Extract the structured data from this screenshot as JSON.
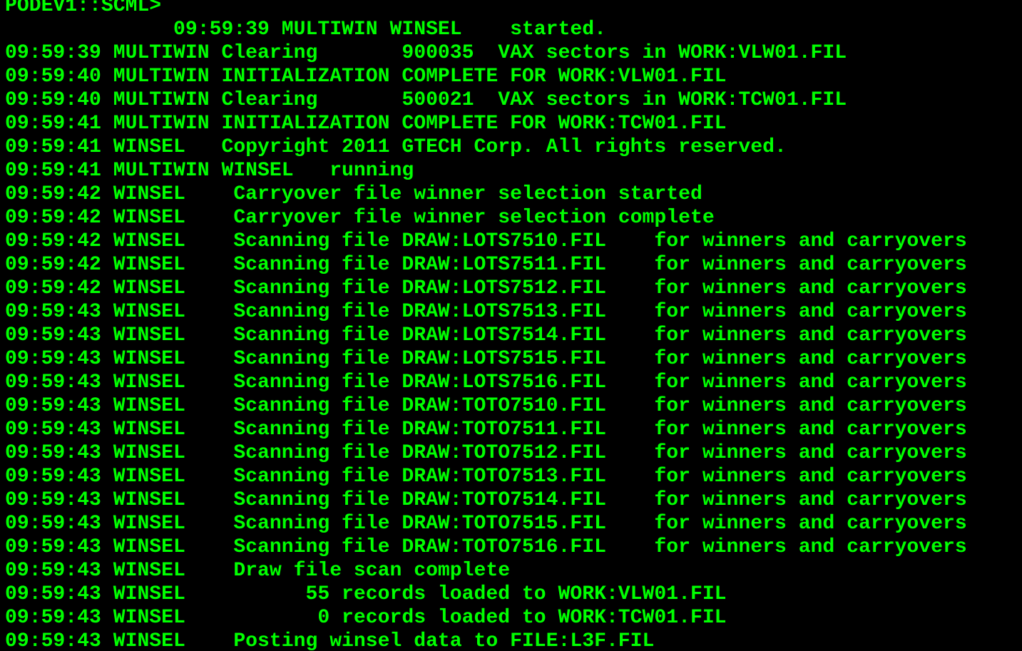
{
  "terminal": {
    "text_color": "#00ff00",
    "background_color": "#000000",
    "lines": [
      "PODEV1::SCML>",
      "              09:59:39 MULTIWIN WINSEL    started.",
      "09:59:39 MULTIWIN Clearing       900035  VAX sectors in WORK:VLW01.FIL",
      "09:59:40 MULTIWIN INITIALIZATION COMPLETE FOR WORK:VLW01.FIL",
      "09:59:40 MULTIWIN Clearing       500021  VAX sectors in WORK:TCW01.FIL",
      "09:59:41 MULTIWIN INITIALIZATION COMPLETE FOR WORK:TCW01.FIL",
      "09:59:41 WINSEL   Copyright 2011 GTECH Corp. All rights reserved.",
      "09:59:41 MULTIWIN WINSEL   running",
      "09:59:42 WINSEL    Carryover file winner selection started",
      "09:59:42 WINSEL    Carryover file winner selection complete",
      "09:59:42 WINSEL    Scanning file DRAW:LOTS7510.FIL    for winners and carryovers",
      "09:59:42 WINSEL    Scanning file DRAW:LOTS7511.FIL    for winners and carryovers",
      "09:59:42 WINSEL    Scanning file DRAW:LOTS7512.FIL    for winners and carryovers",
      "09:59:43 WINSEL    Scanning file DRAW:LOTS7513.FIL    for winners and carryovers",
      "09:59:43 WINSEL    Scanning file DRAW:LOTS7514.FIL    for winners and carryovers",
      "09:59:43 WINSEL    Scanning file DRAW:LOTS7515.FIL    for winners and carryovers",
      "09:59:43 WINSEL    Scanning file DRAW:LOTS7516.FIL    for winners and carryovers",
      "09:59:43 WINSEL    Scanning file DRAW:TOTO7510.FIL    for winners and carryovers",
      "09:59:43 WINSEL    Scanning file DRAW:TOTO7511.FIL    for winners and carryovers",
      "09:59:43 WINSEL    Scanning file DRAW:TOTO7512.FIL    for winners and carryovers",
      "09:59:43 WINSEL    Scanning file DRAW:TOTO7513.FIL    for winners and carryovers",
      "09:59:43 WINSEL    Scanning file DRAW:TOTO7514.FIL    for winners and carryovers",
      "09:59:43 WINSEL    Scanning file DRAW:TOTO7515.FIL    for winners and carryovers",
      "09:59:43 WINSEL    Scanning file DRAW:TOTO7516.FIL    for winners and carryovers",
      "09:59:43 WINSEL    Draw file scan complete",
      "09:59:43 WINSEL          55 records loaded to WORK:VLW01.FIL",
      "09:59:43 WINSEL           0 records loaded to WORK:TCW01.FIL",
      "09:59:43 WINSEL    Posting winsel data to FILE:L3F.FIL"
    ]
  }
}
